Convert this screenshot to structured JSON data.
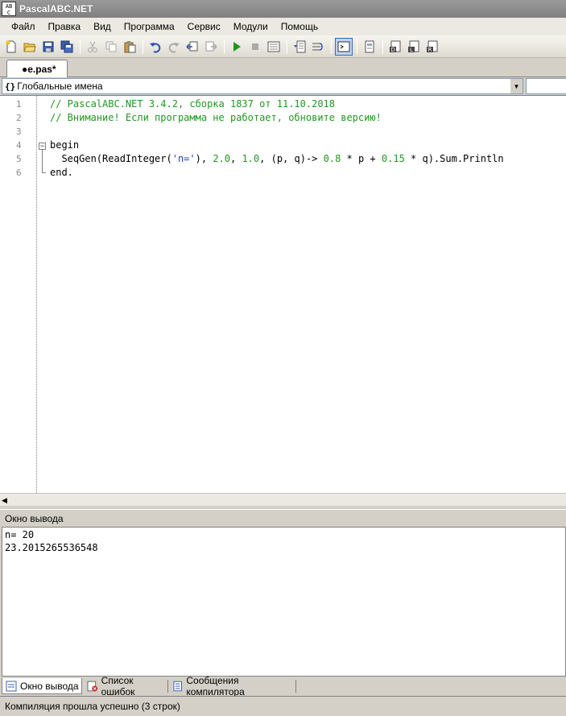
{
  "window": {
    "title": "PascalABC.NET",
    "icon_text": "AB\nC"
  },
  "menu": {
    "items": [
      "Файл",
      "Правка",
      "Вид",
      "Программа",
      "Сервис",
      "Модули",
      "Помощь"
    ]
  },
  "toolbar": {
    "icons": [
      "new-file-icon",
      "open-file-icon",
      "save-icon",
      "save-all-icon",
      "cut-icon",
      "copy-icon",
      "paste-icon",
      "undo-icon",
      "redo-icon",
      "navigate-back-icon",
      "navigate-forward-icon",
      "run-icon",
      "stop-icon",
      "compile-icon",
      "debug-step-icon",
      "debug-step-over-icon",
      "output-window-icon",
      "form-icon",
      "unit-d-icon",
      "unit-l-icon",
      "unit-r-icon"
    ]
  },
  "editor_tab": {
    "label": "●e.pas*"
  },
  "names_bar": {
    "icon": "{}",
    "label": "Глобальные имена"
  },
  "editor": {
    "line_numbers": [
      "1",
      "2",
      "3",
      "4",
      "5",
      "6"
    ],
    "lines": [
      {
        "text": "// PascalABC.NET 3.4.2, сборка 1837 от 11.10.2018"
      },
      {
        "text": "// Внимание! Если программа не работает, обновите версию!"
      },
      {
        "text": ""
      },
      {
        "text": "begin"
      },
      {
        "parts": [
          "  SeqGen(ReadInteger(",
          "'n='",
          "), ",
          "2.0",
          ", ",
          "1.0",
          ", (p, q)-> ",
          "0.8",
          " * p + ",
          "0.15",
          " * q).Sum.Println"
        ]
      },
      {
        "text": "end."
      }
    ]
  },
  "output": {
    "header": "Окно вывода",
    "lines": [
      "n= 20",
      "23.2015265536548"
    ]
  },
  "bottom_tabs": [
    "Окно вывода",
    "Список ошибок",
    "Сообщения компилятора"
  ],
  "status": {
    "text": "Компиляция прошла успешно (3 строк)"
  },
  "colors": {
    "comment": "#1f9a1f",
    "string": "#2040c0",
    "number": "#1f9a1f",
    "titlebar": "#808080"
  }
}
